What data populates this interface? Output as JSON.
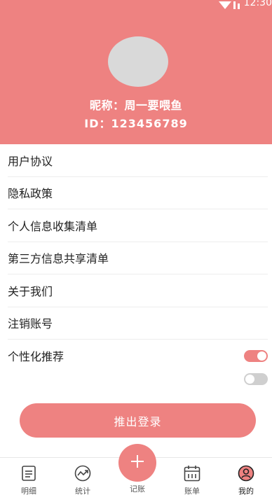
{
  "status_bar": {
    "time": "12:30"
  },
  "profile": {
    "nickname": "昵称：周一要喂鱼",
    "user_id": "ID：123456789"
  },
  "menu": {
    "items": [
      {
        "label": "用户协议"
      },
      {
        "label": "隐私政策"
      },
      {
        "label": "个人信息收集清单"
      },
      {
        "label": "第三方信息共享清单"
      },
      {
        "label": "关于我们"
      },
      {
        "label": "注销账号"
      },
      {
        "label": "个性化推荐"
      }
    ],
    "personalized_toggle": "on",
    "second_toggle": "off"
  },
  "logout": {
    "label": "推出登录"
  },
  "tabbar": {
    "tabs": [
      {
        "label": "明细",
        "icon": "document-icon"
      },
      {
        "label": "统计",
        "icon": "chart-icon"
      },
      {
        "label": "记账",
        "icon": "plus-icon"
      },
      {
        "label": "账单",
        "icon": "calendar-icon"
      },
      {
        "label": "我的",
        "icon": "user-icon"
      }
    ],
    "active": "我的"
  },
  "colors": {
    "accent": "#ee8281",
    "avatar_placeholder": "#d9d9d9",
    "toggle_off": "#cfcfcf"
  }
}
